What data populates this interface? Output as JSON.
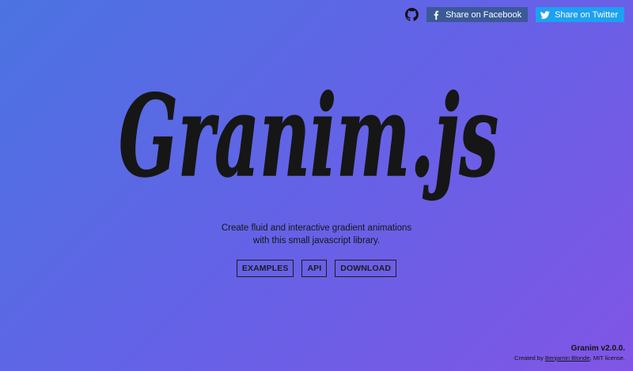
{
  "header": {
    "github_icon": "github-icon",
    "share_facebook": {
      "label": "Share on Facebook",
      "icon": "facebook-icon",
      "color": "#3b5998"
    },
    "share_twitter": {
      "label": "Share on Twitter",
      "icon": "twitter-icon",
      "color": "#1da1f2"
    }
  },
  "hero": {
    "logo_text": "Granim.js",
    "tagline_line1": "Create fluid and interactive gradient animations",
    "tagline_line2": "with this small javascript library."
  },
  "nav": {
    "examples": "EXAMPLES",
    "api": "API",
    "download": "DOWNLOAD"
  },
  "footer": {
    "version": "Granim v2.0.0.",
    "credit_prefix": "Created by ",
    "author": "Benjamin Blonde",
    "credit_suffix": ", MIT license."
  },
  "colors": {
    "gradient_start": "#4b73e2",
    "gradient_mid": "#6462e6",
    "gradient_end": "#8155e6",
    "text": "#141414"
  }
}
